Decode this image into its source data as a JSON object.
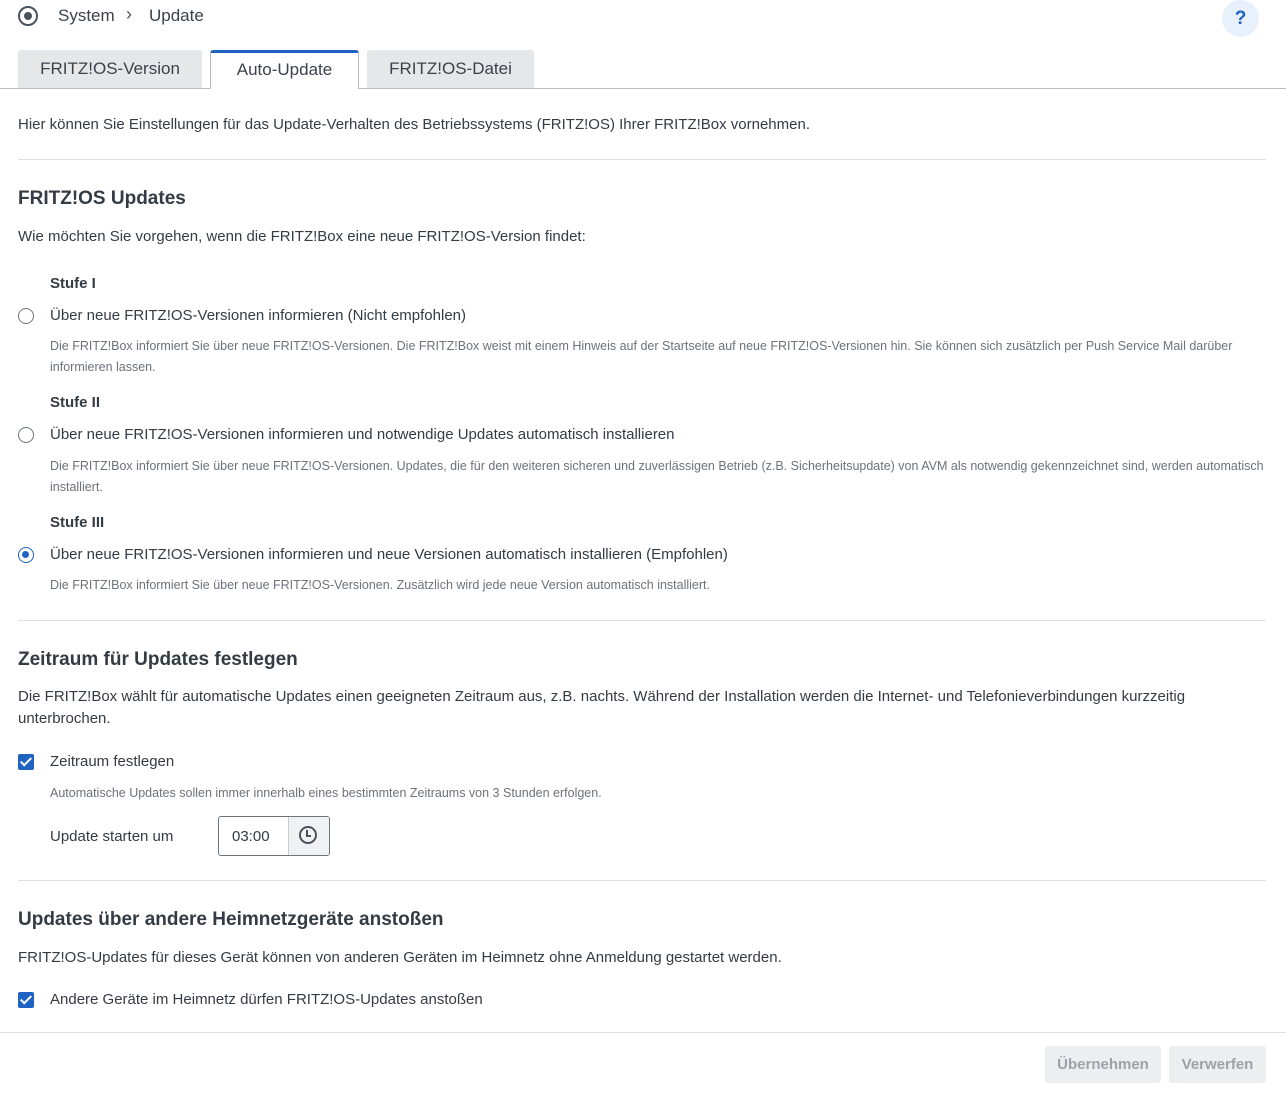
{
  "breadcrumb": {
    "item1": "System",
    "item2": "Update"
  },
  "help_label": "?",
  "tabs": [
    {
      "label": "FRITZ!OS-Version"
    },
    {
      "label": "Auto-Update"
    },
    {
      "label": "FRITZ!OS-Datei"
    }
  ],
  "intro": "Hier können Sie Einstellungen für das Update-Verhalten des Betriebssystems (FRITZ!OS) Ihrer FRITZ!Box vornehmen.",
  "updates": {
    "title": "FRITZ!OS Updates",
    "question": "Wie möchten Sie vorgehen, wenn die FRITZ!Box eine neue FRITZ!OS-Version findet:",
    "options": [
      {
        "level": "Stufe I",
        "label": "Über neue FRITZ!OS-Versionen informieren (Nicht empfohlen)",
        "desc": "Die FRITZ!Box informiert Sie über neue FRITZ!OS-Versionen. Die FRITZ!Box weist mit einem Hinweis auf der Startseite auf neue FRITZ!OS-Versionen hin. Sie können sich zusätzlich per Push Service Mail darüber informieren lassen.",
        "selected": false
      },
      {
        "level": "Stufe II",
        "label": "Über neue FRITZ!OS-Versionen informieren und notwendige Updates automatisch installieren",
        "desc": "Die FRITZ!Box informiert Sie über neue FRITZ!OS-Versionen. Updates, die für den weiteren sicheren und zuverlässigen Betrieb (z.B. Sicherheitsupdate) von AVM als notwendig gekennzeichnet sind, werden automatisch installiert.",
        "selected": false
      },
      {
        "level": "Stufe III",
        "label": "Über neue FRITZ!OS-Versionen informieren und neue Versionen automatisch installieren (Empfohlen)",
        "desc": "Die FRITZ!Box informiert Sie über neue FRITZ!OS-Versionen. Zusätzlich wird jede neue Version automatisch installiert.",
        "selected": true
      }
    ]
  },
  "timeframe": {
    "title": "Zeitraum für Updates festlegen",
    "desc": "Die FRITZ!Box wählt für automatische Updates einen geeigneten Zeitraum aus, z.B. nachts. Während der Installation werden die Internet- und Telefonieverbindungen kurzzeitig unterbrochen.",
    "checkbox_label": "Zeitraum festlegen",
    "checked": true,
    "hint": "Automatische Updates sollen immer innerhalb eines bestimmten Zeitraums von 3 Stunden erfolgen.",
    "start_label": "Update starten um",
    "start_value": "03:00"
  },
  "home_network": {
    "title": "Updates über andere Heimnetzgeräte anstoßen",
    "desc": "FRITZ!OS-Updates für dieses Gerät können von anderen Geräten im Heimnetz ohne Anmeldung gestartet werden.",
    "checkbox_label": "Andere Geräte im Heimnetz dürfen FRITZ!OS-Updates anstoßen",
    "checked": true
  },
  "buttons": {
    "apply": "Übernehmen",
    "discard": "Verwerfen"
  },
  "colors": {
    "accent": "#1e63c2"
  }
}
